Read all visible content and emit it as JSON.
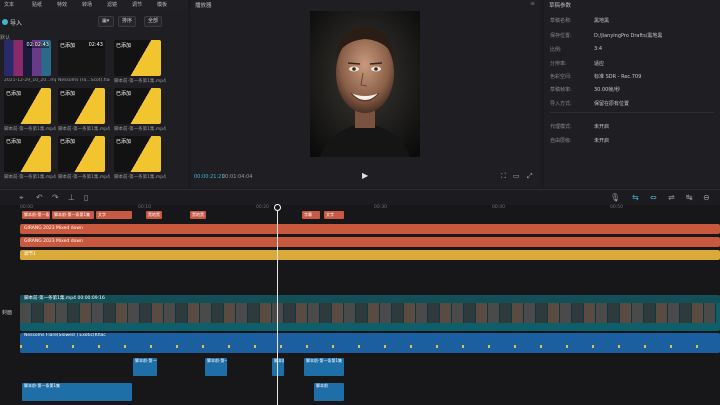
{
  "menu": {
    "items": [
      "文本",
      "贴纸",
      "特效",
      "转场",
      "滤镜",
      "调节",
      "模板"
    ]
  },
  "media": {
    "import_label": "导入",
    "chips": [
      "排序",
      "全部"
    ],
    "side_label": "默认",
    "thumbs": [
      {
        "tag": "",
        "dur": "02:02:43",
        "cap": "2021-12-29_10_20...mp4",
        "style": "colorbars"
      },
      {
        "tag": "已添加",
        "dur": "02:43",
        "cap": "Nessoms (Fa...Scot).flac",
        "style": "dark"
      },
      {
        "tag": "已添加",
        "dur": "",
        "cap": "脚本前-第一条第1集.mp4",
        "style": "yellow"
      },
      {
        "tag": "已添加",
        "dur": "",
        "cap": "脚本前-第一条第1集.mp4",
        "style": "yellow"
      },
      {
        "tag": "已添加",
        "dur": "",
        "cap": "脚本前-第一条第1集.mp4",
        "style": "yellow"
      },
      {
        "tag": "已添加",
        "dur": "",
        "cap": "脚本前-第一条第1集.mp4",
        "style": "yellow"
      },
      {
        "tag": "已添加",
        "dur": "",
        "cap": "脚本前-第一条第1集.mp4",
        "style": "yellow"
      },
      {
        "tag": "已添加",
        "dur": "",
        "cap": "脚本前-第一条第1集.mp4",
        "style": "yellow"
      },
      {
        "tag": "已添加",
        "dur": "",
        "cap": "脚本前-第一条第1集.mp4",
        "style": "yellow"
      }
    ]
  },
  "player": {
    "title": "播放器",
    "current_time": "00:00:21:21",
    "total_time": "00:01:04:04"
  },
  "props": {
    "title": "草稿参数",
    "rows": [
      {
        "k": "草稿名称:",
        "v": "黑地黑"
      },
      {
        "k": "保存位置:",
        "v": "D:/JianyingPro Drafts/黑地黑"
      },
      {
        "k": "比例:",
        "v": "3:4"
      },
      {
        "k": "分辨率:",
        "v": "适应"
      },
      {
        "k": "色彩空间:",
        "v": "标准 SDR - Rec.709"
      },
      {
        "k": "草稿帧率:",
        "v": "30.00帧/秒"
      },
      {
        "k": "导入方式:",
        "v": "保留在原有位置"
      },
      {
        "k": "代理模式:",
        "v": "未开启"
      },
      {
        "k": "自由层级:",
        "v": "未开启"
      }
    ]
  },
  "timeline": {
    "ruler_labels": [
      "00:00",
      "00:10",
      "00:20",
      "00:30",
      "00:40",
      "00:50"
    ],
    "markers": [
      {
        "text": "脚本前-第一条第1集"
      },
      {
        "text": "脚本前-第一条第1集"
      },
      {
        "text": "文字"
      },
      {
        "text": "黑地黑"
      },
      {
        "text": "黑地黑"
      },
      {
        "text": "字幕"
      },
      {
        "text": "文字"
      }
    ],
    "tracks": [
      {
        "label": "GIRANG 2023 Mixed down",
        "color": "#c8593f"
      },
      {
        "label": "GIRANG 2023 Mixed down",
        "color": "#c8593f"
      },
      {
        "label": "调节1",
        "color": "#d9a93a"
      }
    ],
    "video_label": "脚本前-第一条第1集.mp4  00:00:09:16",
    "cover_label": "封面",
    "audio_label": "Nessoms Flare(Slowed ) Exotic(Kflac",
    "sub_clips": [
      "脚本前-第一条",
      "脚本前-第一条",
      "脚本前",
      "脚本前-第一条第1集",
      "脚本前",
      "脚本前-第一条第1集"
    ]
  }
}
